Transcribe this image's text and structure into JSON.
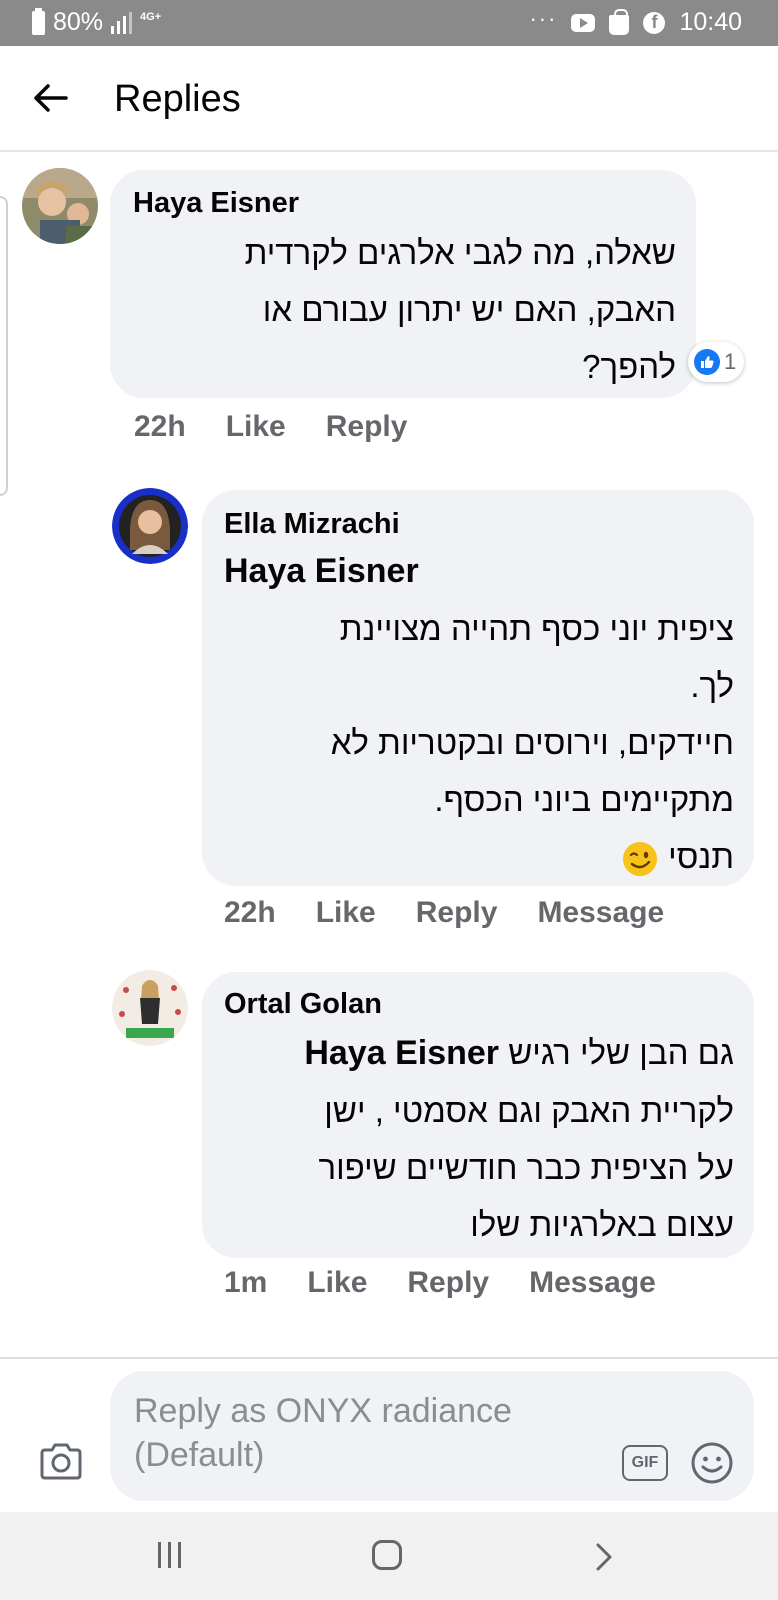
{
  "status_bar": {
    "battery": "80%",
    "network": "4G+",
    "dots": "···",
    "time": "10:40"
  },
  "header": {
    "title": "Replies"
  },
  "comments": [
    {
      "author": "Haya Eisner",
      "text_lines": [
        "שאלה, מה לגבי אלרגים לקרדית",
        "האבק, האם יש יתרון עבורם או",
        "להפך?"
      ],
      "reaction_count": "1",
      "time": "22h",
      "like": "Like",
      "reply": "Reply"
    },
    {
      "author": "Ella Mizrachi",
      "mention": "Haya Eisner",
      "text_lines": [
        "ציפית יוני כסף תהייה מצויינת",
        "לך.",
        "חיידקים, וירוסים ובקטריות לא",
        "מתקיימים ביוני הכסף.",
        "תנסי"
      ],
      "emoji": "winking-face",
      "time": "22h",
      "like": "Like",
      "reply": "Reply",
      "message": "Message"
    },
    {
      "author": "Ortal Golan",
      "mention": "Haya Eisner",
      "first_line_text": "גם הבן שלי רגיש",
      "text_lines": [
        "לקריית האבק וגם אסמטי , ישן",
        "על הציפית כבר חודשיים שיפור",
        "עצום באלרגיות שלו"
      ],
      "time": "1m",
      "like": "Like",
      "reply": "Reply",
      "message": "Message"
    }
  ],
  "composer": {
    "placeholder_line1": "Reply as ONYX radiance",
    "placeholder_line2": "(Default)",
    "gif_label": "GIF"
  },
  "colors": {
    "status_bar": "#8a8a8a",
    "bubble": "#f0f2f5",
    "meta_text": "#65676b",
    "like_blue": "#1877f2"
  }
}
